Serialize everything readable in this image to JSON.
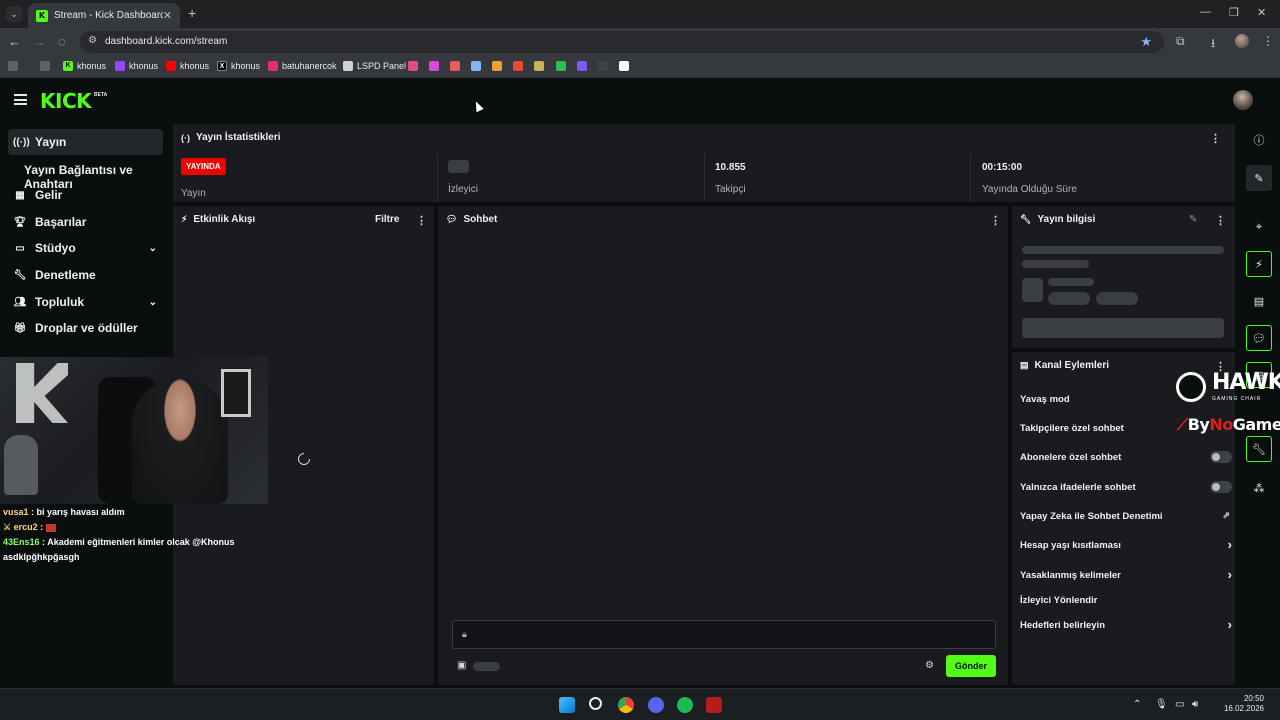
{
  "browser": {
    "tab_title": "Stream - Kick Dashboard",
    "tab_close": "✕",
    "new_tab": "+",
    "url": "dashboard.kick.com/stream",
    "bookmarks": [
      {
        "label": "khonus",
        "icon": "kick-icon",
        "color": "#53fc18"
      },
      {
        "label": "khonus",
        "icon": "twitch-icon",
        "color": "#9146ff"
      },
      {
        "label": "khonus",
        "icon": "youtube-icon",
        "color": "#ff0000"
      },
      {
        "label": "khonus",
        "icon": "x-icon",
        "color": "#ffffff"
      },
      {
        "label": "batuhanercok",
        "icon": "instagram-icon",
        "color": "#e1306c"
      },
      {
        "label": "LSPD Panel",
        "icon": "lspd-icon",
        "color": "#d0d0d0"
      }
    ]
  },
  "app": {
    "logo": "KICK",
    "logo_badge": "BETA"
  },
  "sidebar": {
    "items": [
      {
        "label": "Yayın",
        "icon": "broadcast-icon"
      },
      {
        "label": "Yayın Bağlantısı ve Anahtarı"
      },
      {
        "label": "Gelir",
        "icon": "revenue-icon"
      },
      {
        "label": "Başarılar",
        "icon": "trophy-icon"
      },
      {
        "label": "Stüdyo",
        "icon": "studio-icon"
      },
      {
        "label": "Denetleme",
        "icon": "wrench-icon"
      },
      {
        "label": "Topluluk",
        "icon": "community-icon"
      },
      {
        "label": "Droplar ve ödüller",
        "icon": "gift-icon"
      }
    ]
  },
  "overlay_chat": [
    {
      "user": "vusa1",
      "msg": " : bi yarış havası aldım"
    },
    {
      "user": "ercu2",
      "msg": " : "
    },
    {
      "user": "43Ens16",
      "msg": " : Akademi eğitmenleri kimler olcak @Khonus"
    },
    {
      "user": "",
      "msg": "asdklpğhkpğasgh"
    }
  ],
  "stats": {
    "title": "Yayın İstatistikleri",
    "live_badge": "YAYINDA",
    "status_label": "Yayın",
    "viewers_label": "İzleyici",
    "followers_value": "10.855",
    "followers_label": "Takipçi",
    "uptime_value": "00:15:00",
    "uptime_label": "Yayında Olduğu Süre"
  },
  "activity": {
    "title": "Etkinlik Akışı",
    "filter": "Filtre"
  },
  "chat": {
    "title": "Sohbet",
    "send": "Gönder"
  },
  "stream_info": {
    "title": "Yayın bilgisi"
  },
  "channel_actions": {
    "title": "Kanal Eylemleri",
    "rows": [
      {
        "label": "Yavaş mod"
      },
      {
        "label": "Takipçilere özel sohbet"
      },
      {
        "label": "Abonelere özel sohbet",
        "toggle": "off"
      },
      {
        "label": "Yalnızca ifadelerle sohbet",
        "toggle": "off"
      },
      {
        "label": "Yapay Zeka ile Sohbet Denetimi",
        "icon": "external-link-icon"
      },
      {
        "label": "Hesap yaşı kısıtlaması",
        "icon": "chevron-right-icon"
      },
      {
        "label": "Yasaklanmış kelimeler",
        "icon": "chevron-right-icon"
      },
      {
        "label": "İzleyici Yönlendir"
      },
      {
        "label": "Hedefleri belirleyin",
        "icon": "chevron-right-icon"
      }
    ]
  },
  "sponsors": {
    "hawk": "HAWK",
    "hawk_sub": "GAMING CHAIR",
    "bynogame_prefix": "By",
    "bynogame_mid": "No",
    "bynogame_suffix": "Game"
  },
  "taskbar": {
    "time": "20:50",
    "date": "16.02.2026"
  }
}
